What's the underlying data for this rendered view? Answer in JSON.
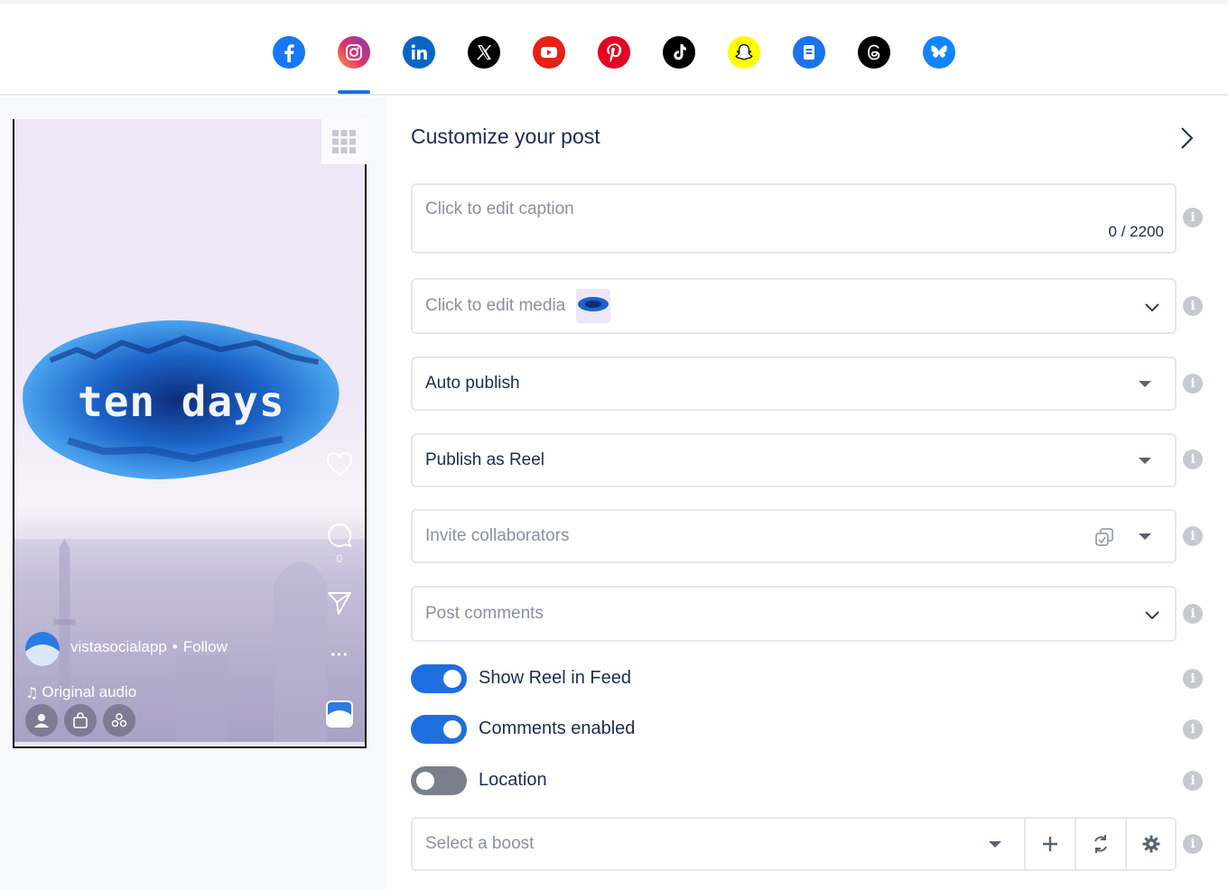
{
  "networks": [
    {
      "name": "facebook",
      "icon": "facebook-icon",
      "color": "#1877f2"
    },
    {
      "name": "instagram",
      "icon": "instagram-icon",
      "color": "#d62976",
      "active": true
    },
    {
      "name": "linkedin",
      "icon": "linkedin-icon",
      "color": "#0a66c2"
    },
    {
      "name": "x",
      "icon": "x-icon",
      "color": "#000000"
    },
    {
      "name": "youtube",
      "icon": "youtube-icon",
      "color": "#e62117"
    },
    {
      "name": "pinterest",
      "icon": "pinterest-icon",
      "color": "#e60023"
    },
    {
      "name": "tiktok",
      "icon": "tiktok-icon",
      "color": "#000000"
    },
    {
      "name": "snapchat",
      "icon": "snapchat-icon",
      "color": "#fffc00"
    },
    {
      "name": "google-business",
      "icon": "google-business-icon",
      "color": "#1a73e8"
    },
    {
      "name": "threads",
      "icon": "threads-icon",
      "color": "#000000"
    },
    {
      "name": "bluesky",
      "icon": "bluesky-icon",
      "color": "#1185fe"
    }
  ],
  "preview": {
    "overlay_text": "ten days",
    "likes": "0",
    "comments": "0",
    "username": "vistasocialapp",
    "separator": "•",
    "follow": "Follow",
    "audio": "Original audio"
  },
  "panel": {
    "title": "Customize your post",
    "caption_placeholder": "Click to edit caption",
    "caption_counter": "0 / 2200",
    "media_placeholder": "Click to edit media",
    "publish_mode": "Auto publish",
    "publish_type": "Publish as Reel",
    "collaborators_placeholder": "Invite collaborators",
    "comments_placeholder": "Post comments",
    "toggles": [
      {
        "label": "Show Reel in Feed",
        "on": true
      },
      {
        "label": "Comments enabled",
        "on": true
      },
      {
        "label": "Location",
        "on": false
      }
    ],
    "boost_placeholder": "Select a boost"
  },
  "colors": {
    "accent": "#1f6ee0",
    "text_dark": "#1b2b55",
    "placeholder": "#8b90a0"
  }
}
